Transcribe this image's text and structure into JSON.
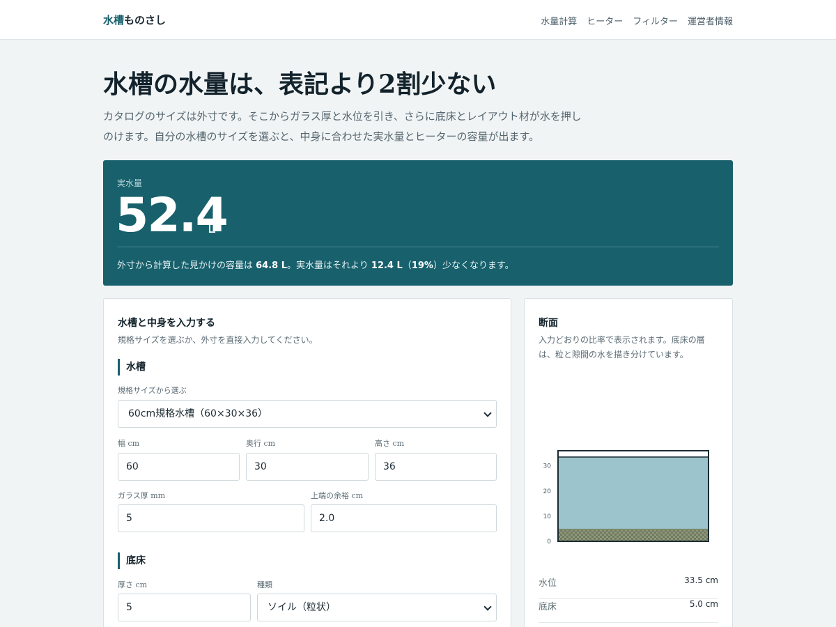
{
  "header": {
    "brand_accent": "水槽",
    "brand_rest": "ものさし",
    "nav": [
      "水量計算",
      "ヒーター",
      "フィルター",
      "運営者情報"
    ]
  },
  "hero": {
    "title": "水槽の水量は、表記より2割少ない",
    "subtitle": "カタログのサイズは外寸です。そこからガラス厚と水位を引き、さらに底床とレイアウト材が水を押しのけます。自分の水槽のサイズを選ぶと、中身に合わせた実水量とヒーターの容量が出ます。"
  },
  "result": {
    "label": "実水量",
    "value": "52.4",
    "unit": "L",
    "note_prefix": "外寸から計算した見かけの容量は ",
    "apparent": "64.8 L",
    "note_mid": "。実水量はそれより ",
    "diff": "12.4 L",
    "paren_open": "（",
    "percent": "19%",
    "note_suffix": "）少なくなります。"
  },
  "input_card": {
    "title": "水槽と中身を入力する",
    "description": "規格サイズを選ぶか、外寸を直接入力してください。",
    "tank_section": "水槽",
    "preset_label": "規格サイズから選ぶ",
    "preset_value": "60cm規格水槽（60×30×36）",
    "width_label": "幅 cm",
    "width_value": "60",
    "depth_label": "奥行 cm",
    "depth_value": "30",
    "height_label": "高さ cm",
    "height_value": "36",
    "glass_label": "ガラス厚 mm",
    "glass_value": "5",
    "margin_label": "上端の余裕 cm",
    "margin_value": "2.0",
    "substrate_section": "底床",
    "thickness_label": "厚さ cm",
    "thickness_value": "5",
    "type_label": "種類",
    "type_value": "ソイル（粒状）"
  },
  "section_card": {
    "title": "断面",
    "description": "入力どおりの比率で表示されます。底床の層は、粒と隙間の水を描き分けています。",
    "y_ticks": [
      "30",
      "20",
      "10",
      "0"
    ],
    "tank_height_cm": 36,
    "water_level_cm": 33.5,
    "substrate_cm": 5,
    "colors": {
      "water": "#9bc4cc",
      "substrate": "#7f8a6c",
      "frame": "#1c2b33"
    },
    "stats": [
      {
        "label": "水位",
        "value": "33.5 cm"
      },
      {
        "label": "底床",
        "value": "5.0 cm"
      }
    ]
  }
}
